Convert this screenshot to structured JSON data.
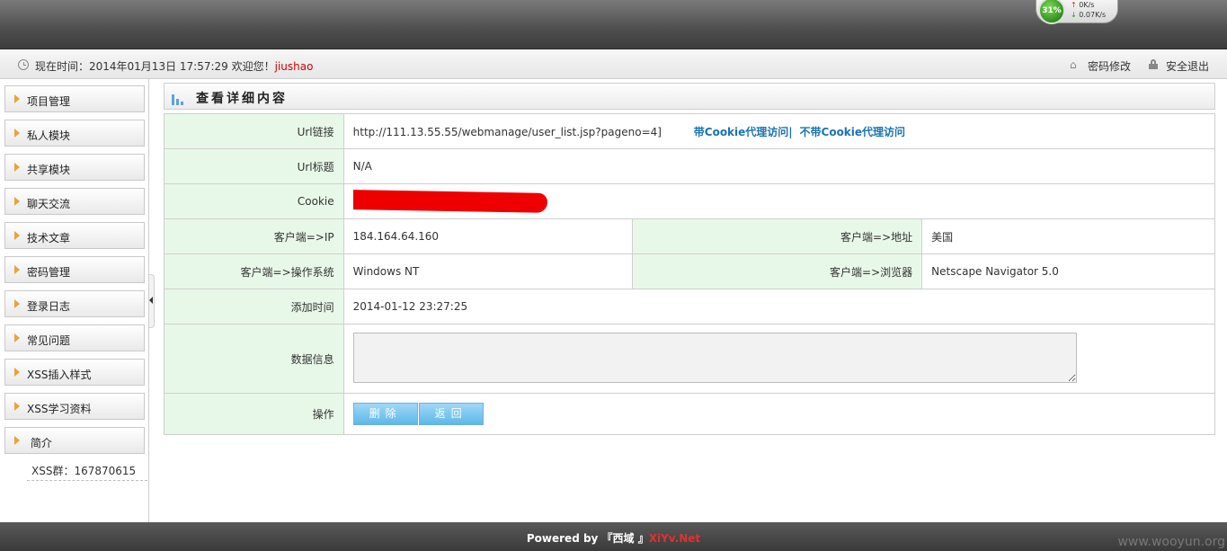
{
  "header": {
    "net_widget": {
      "percent": "31%",
      "upload": "0K/s",
      "download": "0.07K/s"
    }
  },
  "infobar": {
    "time_text": "现在时间：2014年01月13日 17:57:29 欢迎您！",
    "username": "jiushao",
    "change_password": "密码修改",
    "logout": "安全退出"
  },
  "sidebar": {
    "items": [
      {
        "label": "项目管理"
      },
      {
        "label": "私人模块"
      },
      {
        "label": "共享模块"
      },
      {
        "label": "聊天交流"
      },
      {
        "label": "技术文章"
      },
      {
        "label": "密码管理"
      },
      {
        "label": "登录日志"
      },
      {
        "label": "常见问题"
      },
      {
        "label": "XSS插入样式"
      },
      {
        "label": "XSS学习资料"
      },
      {
        "label": " 简介"
      }
    ],
    "qq_group": "XSS群：167870615"
  },
  "panel": {
    "title": "查看详细内容",
    "rows": {
      "url_label": "Url链接",
      "url_value": "http://111.13.55.55/webmanage/user_list.jsp?pageno=4]",
      "proxy_with_cookie": "带Cookie代理访问",
      "proxy_sep": "|",
      "proxy_without_cookie": "不带Cookie代理访问",
      "title_label": "Url标题",
      "title_value": "N/A",
      "cookie_label": "Cookie",
      "ip_label": "客户端=>IP",
      "ip_value": "184.164.64.160",
      "addr_label": "客户端=>地址",
      "addr_value": "美国",
      "os_label": "客户端=>操作系统",
      "os_value": "Windows NT",
      "browser_label": "客户端=>浏览器",
      "browser_value": "Netscape Navigator 5.0",
      "added_label": "添加时间",
      "added_value": "2014-01-12 23:27:25",
      "data_label": "数据信息",
      "data_value": "",
      "action_label": "操作",
      "delete_btn": "删除",
      "back_btn": "返回"
    }
  },
  "footer": {
    "powered_prefix": "Powered by 『西域 』",
    "site": "XiYv.Net"
  },
  "watermark": "www.wooyun.org",
  "colors": {
    "label_bg": "#e8f8e8",
    "link": "#1a74b0",
    "username": "#d40000",
    "button": "#5db8e8",
    "redaction": "#ee0000"
  }
}
